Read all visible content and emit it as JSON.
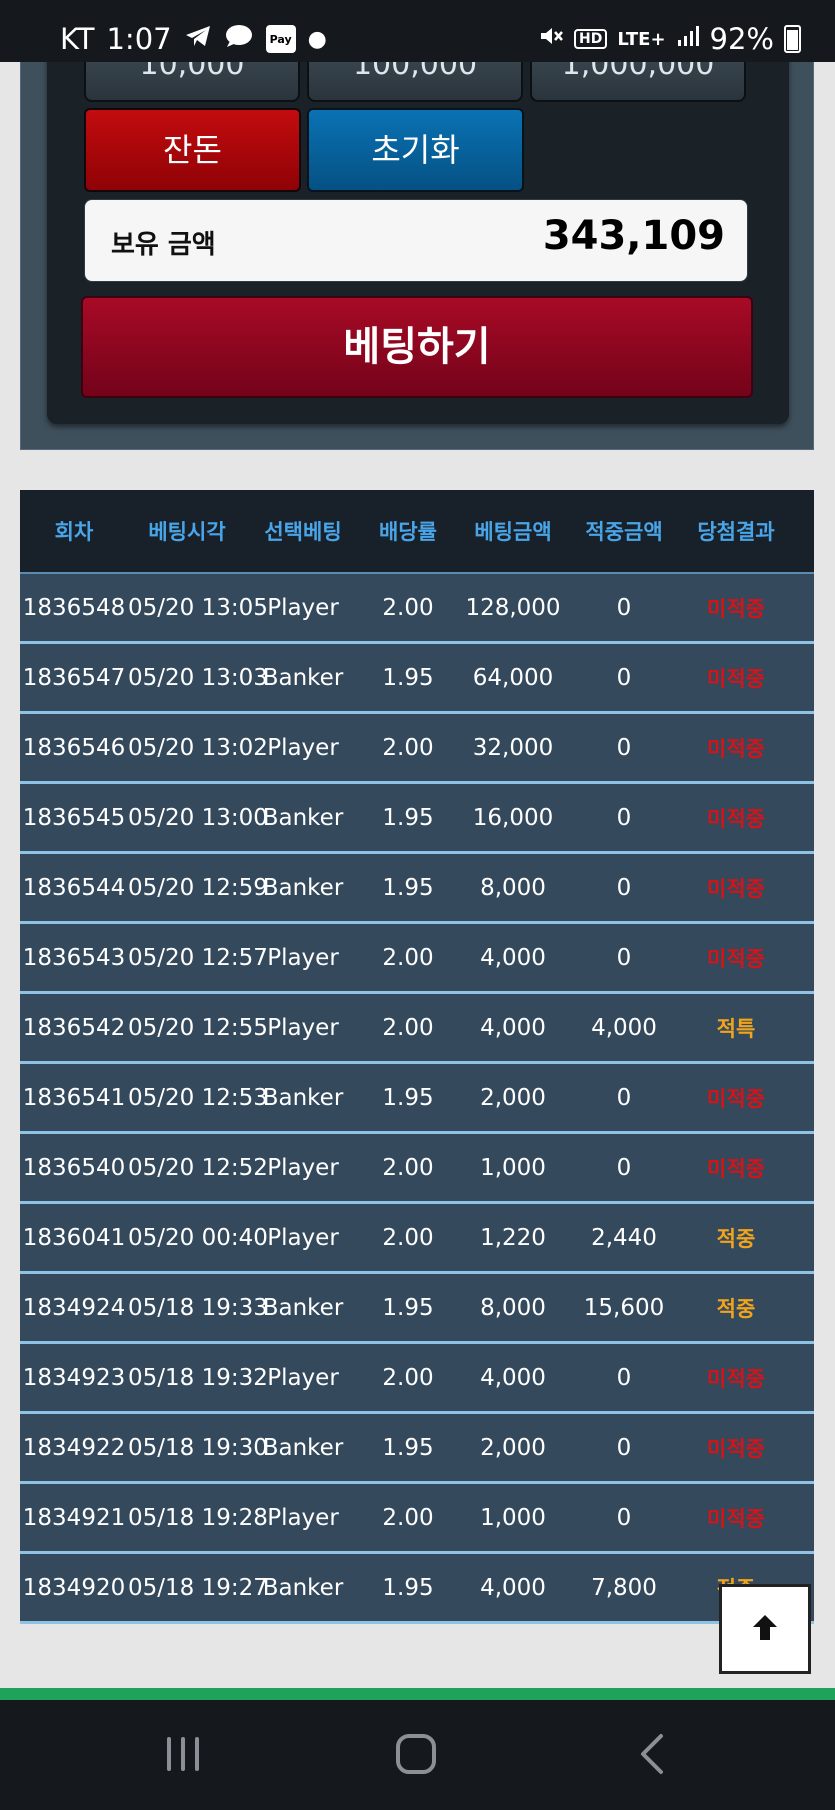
{
  "status_bar": {
    "carrier": "KT",
    "time": "1:07",
    "pay_icon_text": "Pay",
    "hd": "HD",
    "network": "LTE+",
    "battery": "92%"
  },
  "bet_panel": {
    "chips": [
      "10,000",
      "100,000",
      "1,000,000"
    ],
    "remainder_button": "잔돈",
    "reset_button": "초기화",
    "balance_label": "보유 금액",
    "balance_value": "343,109",
    "bet_button": "베팅하기"
  },
  "history": {
    "headers": [
      "회차",
      "베팅시각",
      "선택베팅",
      "배당률",
      "베팅금액",
      "적중금액",
      "당첨결과"
    ],
    "rows": [
      {
        "round": "1836548",
        "time": "05/20 13:05",
        "pick": "Player",
        "odds": "2.00",
        "bet": "128,000",
        "win": "0",
        "result": "미적중",
        "status": "lose"
      },
      {
        "round": "1836547",
        "time": "05/20 13:03",
        "pick": "Banker",
        "odds": "1.95",
        "bet": "64,000",
        "win": "0",
        "result": "미적중",
        "status": "lose"
      },
      {
        "round": "1836546",
        "time": "05/20 13:02",
        "pick": "Player",
        "odds": "2.00",
        "bet": "32,000",
        "win": "0",
        "result": "미적중",
        "status": "lose"
      },
      {
        "round": "1836545",
        "time": "05/20 13:00",
        "pick": "Banker",
        "odds": "1.95",
        "bet": "16,000",
        "win": "0",
        "result": "미적중",
        "status": "lose"
      },
      {
        "round": "1836544",
        "time": "05/20 12:59",
        "pick": "Banker",
        "odds": "1.95",
        "bet": "8,000",
        "win": "0",
        "result": "미적중",
        "status": "lose"
      },
      {
        "round": "1836543",
        "time": "05/20 12:57",
        "pick": "Player",
        "odds": "2.00",
        "bet": "4,000",
        "win": "0",
        "result": "미적중",
        "status": "lose"
      },
      {
        "round": "1836542",
        "time": "05/20 12:55",
        "pick": "Player",
        "odds": "2.00",
        "bet": "4,000",
        "win": "4,000",
        "result": "적특",
        "status": "win"
      },
      {
        "round": "1836541",
        "time": "05/20 12:53",
        "pick": "Banker",
        "odds": "1.95",
        "bet": "2,000",
        "win": "0",
        "result": "미적중",
        "status": "lose"
      },
      {
        "round": "1836540",
        "time": "05/20 12:52",
        "pick": "Player",
        "odds": "2.00",
        "bet": "1,000",
        "win": "0",
        "result": "미적중",
        "status": "lose"
      },
      {
        "round": "1836041",
        "time": "05/20 00:40",
        "pick": "Player",
        "odds": "2.00",
        "bet": "1,220",
        "win": "2,440",
        "result": "적중",
        "status": "win"
      },
      {
        "round": "1834924",
        "time": "05/18 19:33",
        "pick": "Banker",
        "odds": "1.95",
        "bet": "8,000",
        "win": "15,600",
        "result": "적중",
        "status": "win"
      },
      {
        "round": "1834923",
        "time": "05/18 19:32",
        "pick": "Player",
        "odds": "2.00",
        "bet": "4,000",
        "win": "0",
        "result": "미적중",
        "status": "lose"
      },
      {
        "round": "1834922",
        "time": "05/18 19:30",
        "pick": "Banker",
        "odds": "1.95",
        "bet": "2,000",
        "win": "0",
        "result": "미적중",
        "status": "lose"
      },
      {
        "round": "1834921",
        "time": "05/18 19:28",
        "pick": "Player",
        "odds": "2.00",
        "bet": "1,000",
        "win": "0",
        "result": "미적중",
        "status": "lose"
      },
      {
        "round": "1834920",
        "time": "05/18 19:27",
        "pick": "Banker",
        "odds": "1.95",
        "bet": "4,000",
        "win": "7,800",
        "result": "적중",
        "status": "win"
      }
    ]
  },
  "colors": {
    "lose": "#d41418",
    "win": "#f2a51c",
    "header_text": "#4aa5e8",
    "row_bg": "#34495c"
  },
  "icons": {
    "scroll_top": "arrow-up-icon",
    "nav": [
      "recent-apps-icon",
      "home-icon",
      "back-icon"
    ]
  }
}
